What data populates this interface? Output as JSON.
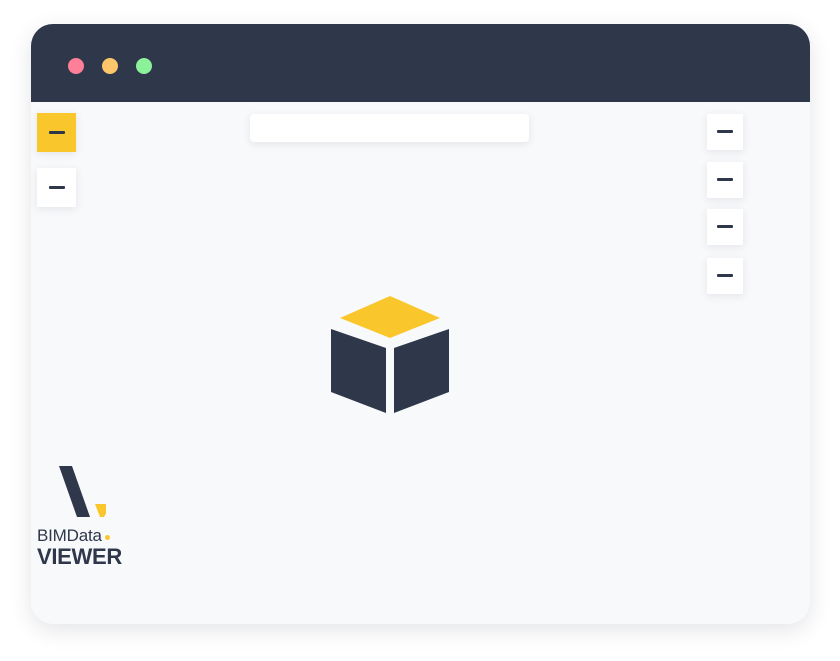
{
  "window": {
    "controls": [
      "close",
      "minimize",
      "maximize"
    ],
    "colors": {
      "titlebar": "#2f374b",
      "background": "#f8f9fb",
      "close": "#fe7f97",
      "minimize": "#fdc66a",
      "maximize": "#8cf29a"
    }
  },
  "toolbar": {
    "left_buttons": [
      {
        "icon": "minus-icon",
        "active": true
      },
      {
        "icon": "minus-icon",
        "active": false
      }
    ],
    "right_buttons": [
      {
        "icon": "minus-icon"
      },
      {
        "icon": "minus-icon"
      },
      {
        "icon": "minus-icon"
      },
      {
        "icon": "minus-icon"
      }
    ],
    "search": {
      "value": ""
    }
  },
  "viewer": {
    "model_icon": "cube-icon"
  },
  "brand": {
    "name": "BIMData",
    "product": "VIEWER",
    "colors": {
      "dark": "#2f374b",
      "accent": "#f9c72c"
    }
  }
}
